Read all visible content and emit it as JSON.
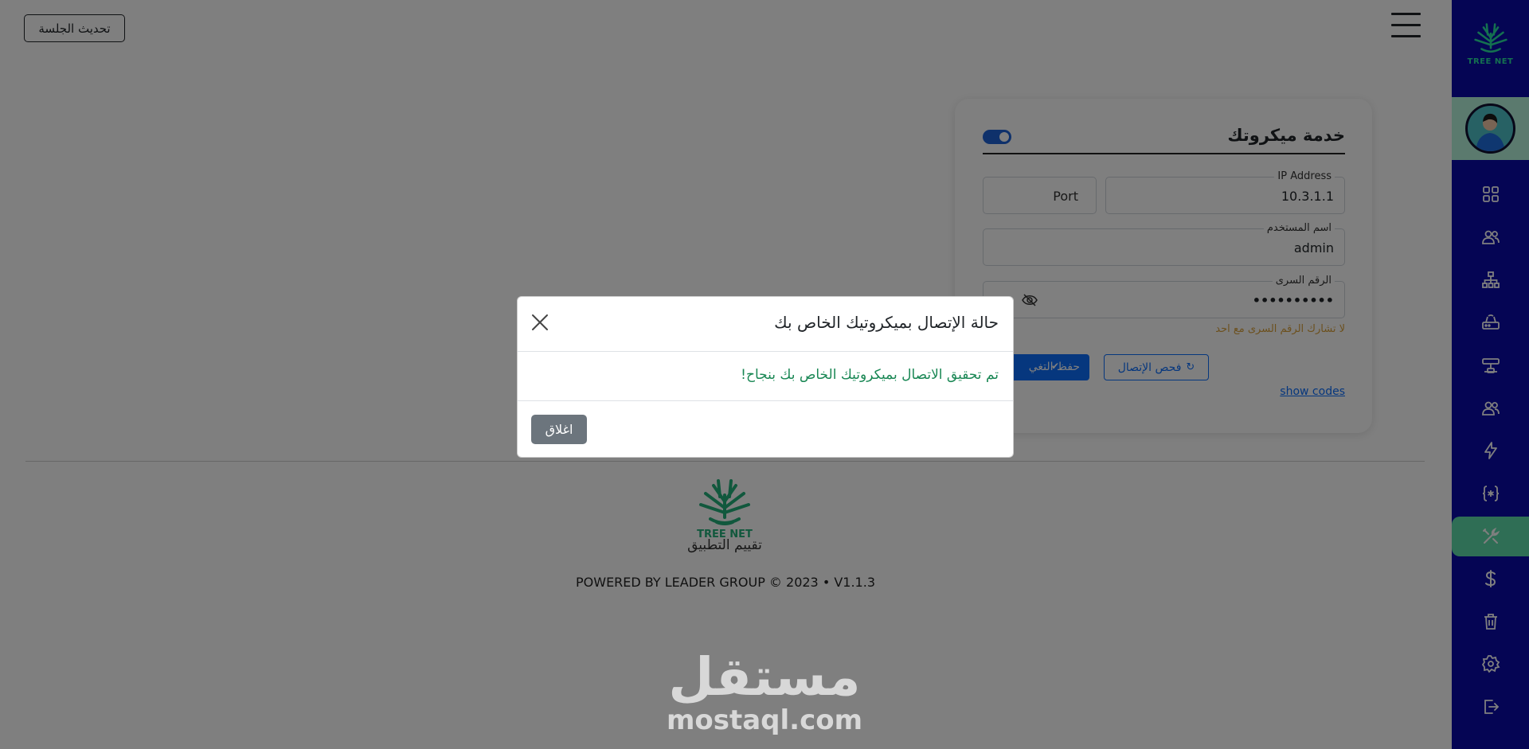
{
  "header": {
    "refresh_label": "تحديث الجلسة"
  },
  "sidebar": {
    "logo_text": "TREE NET",
    "items": [
      {
        "icon": "dashboard-grid-icon"
      },
      {
        "icon": "users-icon"
      },
      {
        "icon": "network-tree-icon"
      },
      {
        "icon": "router-icon"
      },
      {
        "icon": "server-icon"
      },
      {
        "icon": "group-icon"
      },
      {
        "icon": "lightning-icon"
      },
      {
        "icon": "code-braces-icon"
      },
      {
        "icon": "tools-icon",
        "active": true
      },
      {
        "icon": "dollar-icon"
      },
      {
        "icon": "trash-icon"
      },
      {
        "icon": "settings-icon"
      },
      {
        "icon": "logout-icon"
      }
    ]
  },
  "card": {
    "title": "خدمة ميكروتك",
    "toggle_on": true,
    "ip": {
      "label": "IP Address",
      "value": "10.3.1.1"
    },
    "port": {
      "placeholder": "Port"
    },
    "username": {
      "label": "اسم المستخدم",
      "value": "admin"
    },
    "password": {
      "label": "الرقم السرى",
      "value": "••••••••••"
    },
    "warning": "لا تشارك الرقم السرى مع احد",
    "save_label": "حفظ التغي",
    "check_label": "فحص الإتصال",
    "show_codes": "show codes"
  },
  "footer": {
    "logo_text": "TREE NET",
    "rate_label": "تقييم التطبيق",
    "powered": "POWERED BY LEADER GROUP © 2023 • V1.1.3"
  },
  "watermark": {
    "arabic": "مستقل",
    "latin": "mostaql.com"
  },
  "modal": {
    "title": "حالة الإتصال بميكروتيك الخاص بك",
    "message": "تم تحقيق الاتصال بميكروتيك الخاص بك بنجاح!",
    "close_label": "اغلاق"
  },
  "colors": {
    "sidebar": "#0b0ba8",
    "accent": "#5edcaa",
    "primary": "#0d6efd",
    "success": "#198754",
    "warning": "#d9a13b"
  }
}
